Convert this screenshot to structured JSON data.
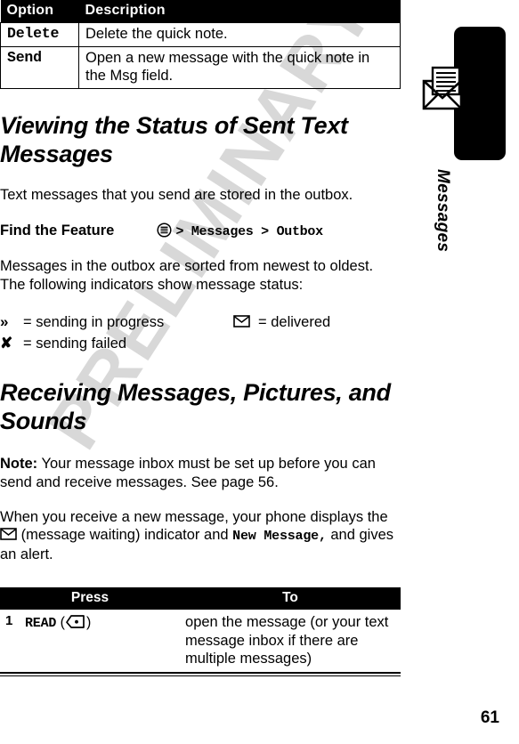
{
  "page": {
    "number": "61",
    "watermark": "PRELIMINARY"
  },
  "sidebar": {
    "label": "Messages",
    "icon": "envelope-letter-icon"
  },
  "option_table": {
    "headers": [
      "Option",
      "Description"
    ],
    "rows": [
      {
        "option": "Delete",
        "description": "Delete the quick note."
      },
      {
        "option": "Send",
        "description": "Open a new message with the quick note in the Msg field."
      }
    ]
  },
  "section_sent": {
    "heading": "Viewing the Status of Sent Text Messages",
    "intro": "Text messages that you send are stored in the outbox.",
    "find_the_feature": {
      "label": "Find the Feature",
      "menu_icon": "menu-circle-icon",
      "path": "> Messages > Outbox"
    },
    "sorted_text_line1": "Messages in the outbox are sorted from newest to oldest.",
    "sorted_text_line2": "The following indicators show message status:",
    "indicators": [
      {
        "glyph": "»",
        "icon": "chevron-double-right-icon",
        "text": "= sending in progress"
      },
      {
        "glyph": "✉",
        "icon": "envelope-icon",
        "text": "= delivered"
      },
      {
        "glyph": "✘",
        "icon": "x-mark-icon",
        "text": "= sending failed"
      }
    ]
  },
  "section_receiving": {
    "heading": "Receiving Messages, Pictures, and Sounds",
    "note_label": "Note:",
    "note_text": "Your message inbox must be set up before you can send and receive messages. See page 56.",
    "paragraph_pre": "When you receive a new message, your phone displays the",
    "paragraph_mid": "(message waiting) indicator and",
    "paragraph_code": "New Message,",
    "paragraph_post": "and gives an alert.",
    "envelope_icon": "envelope-icon"
  },
  "press_table": {
    "headers": [
      "Press",
      "To"
    ],
    "rows": [
      {
        "num": "1",
        "key_label": "READ",
        "key_icon": "left-softkey-icon",
        "to": "open the message (or your text message inbox if there are multiple messages)"
      }
    ]
  }
}
